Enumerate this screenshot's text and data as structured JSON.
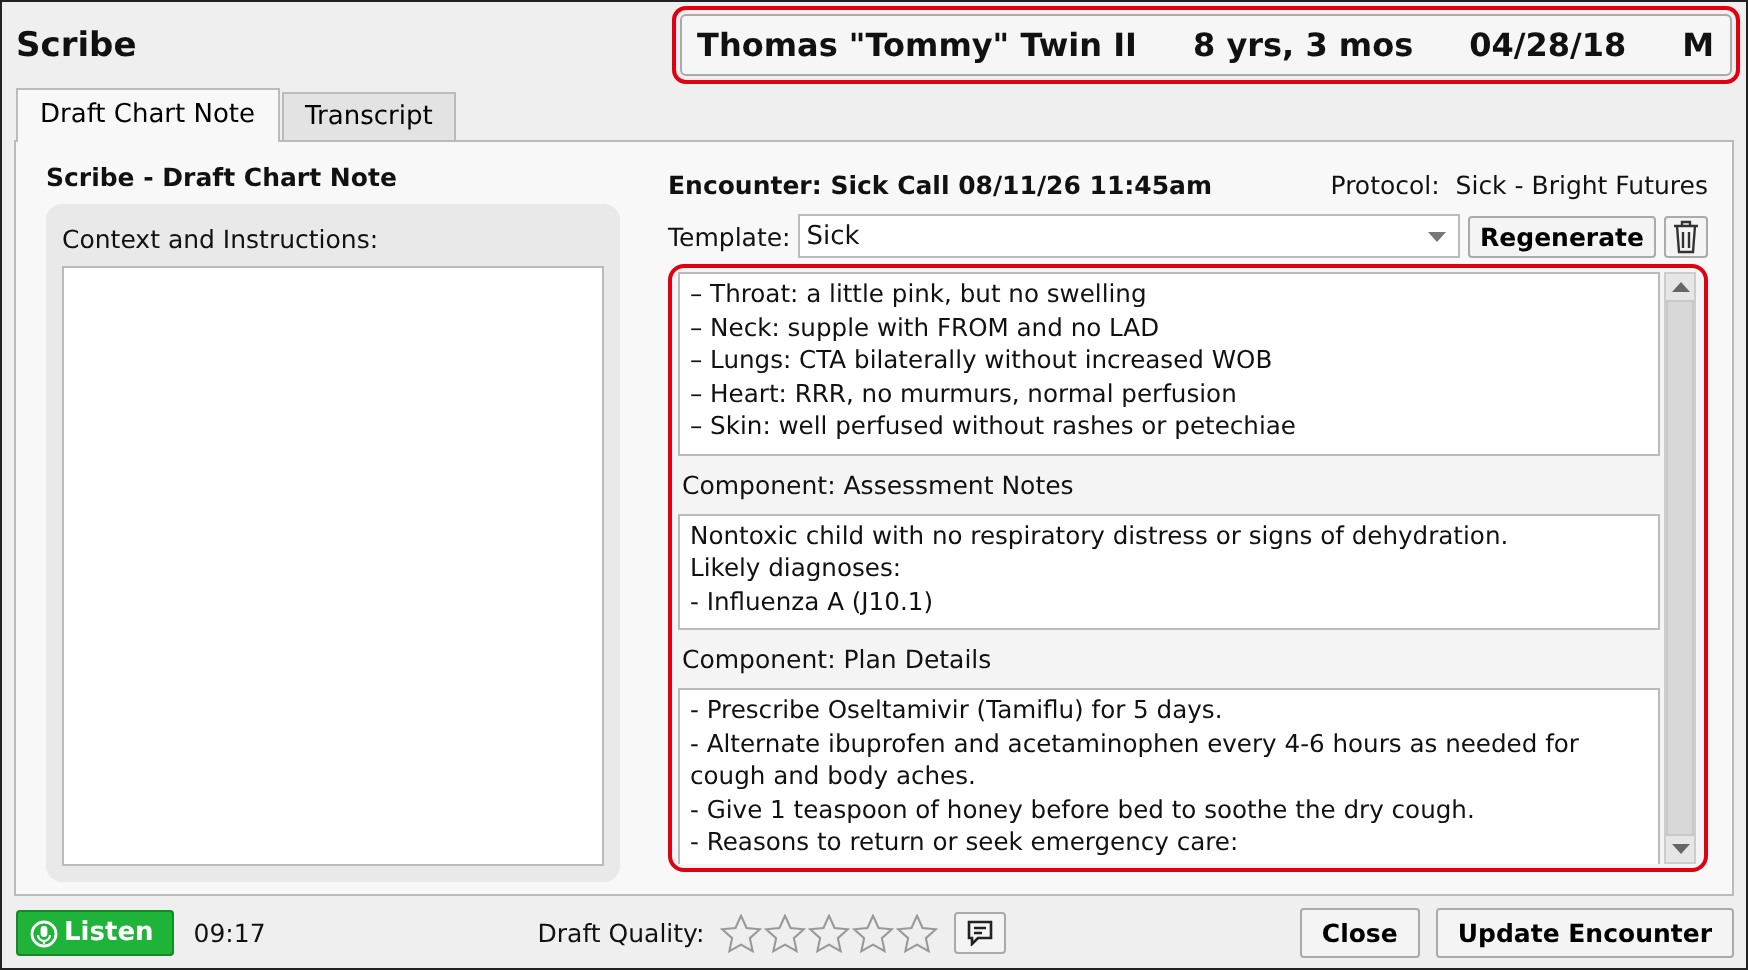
{
  "window": {
    "title": "Scribe"
  },
  "patient": {
    "name": "Thomas \"Tommy\" Twin II",
    "age": "8 yrs, 3 mos",
    "dob": "04/28/18",
    "sex": "M"
  },
  "tabs": [
    {
      "label": "Draft Chart Note",
      "selected": true
    },
    {
      "label": "Transcript",
      "selected": false
    }
  ],
  "left": {
    "heading": "Scribe - Draft Chart Note",
    "context_label": "Context and Instructions:"
  },
  "encounter": "Encounter: Sick Call 08/11/26 11:45am",
  "protocol": {
    "label": "Protocol:",
    "value": "Sick - Bright Futures"
  },
  "template": {
    "label": "Template:",
    "value": "Sick",
    "regenerate": "Regenerate"
  },
  "note_sections": [
    {
      "lines": [
        "– Throat: a little pink, but no swelling",
        "– Neck: supple with FROM and no LAD",
        "– Lungs: CTA bilaterally without increased WOB",
        "– Heart: RRR, no murmurs, normal perfusion",
        "– Skin: well perfused without rashes or petechiae"
      ]
    },
    {
      "header": "Component: Assessment Notes",
      "lines": [
        "Nontoxic child with no respiratory distress or signs of dehydration.",
        "Likely diagnoses:",
        "-   Influenza A (J10.1)"
      ]
    },
    {
      "header": "Component: Plan Details",
      "lines": [
        "-   Prescribe Oseltamivir (Tamiflu) for 5 days.",
        "-   Alternate ibuprofen and acetaminophen every 4-6 hours as needed for cough and body aches.",
        "-   Give 1 teaspoon of honey before bed to soothe the dry cough.",
        "-   Reasons to return or seek emergency care:"
      ]
    }
  ],
  "footer": {
    "listen": "Listen",
    "timer": "09:17",
    "quality_label": "Draft Quality:",
    "stars": 0,
    "close": "Close",
    "update": "Update Encounter"
  }
}
